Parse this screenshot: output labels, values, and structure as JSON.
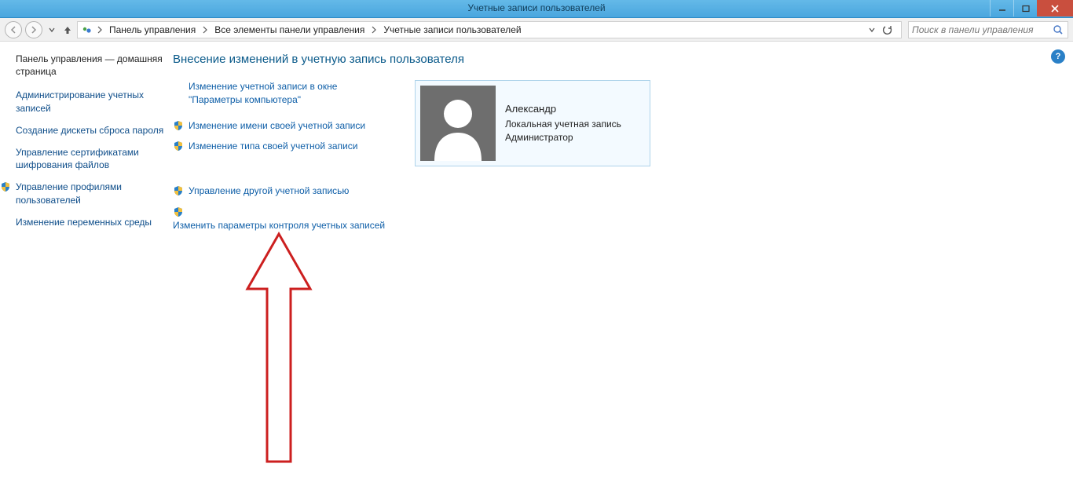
{
  "window": {
    "title": "Учетные записи пользователей"
  },
  "breadcrumb": {
    "items": [
      "Панель управления",
      "Все элементы панели управления",
      "Учетные записи пользователей"
    ]
  },
  "search": {
    "placeholder": "Поиск в панели управления"
  },
  "sidebar": {
    "heading": "Панель управления — домашняя страница",
    "links": [
      {
        "label": "Администрирование учетных записей",
        "shield": false
      },
      {
        "label": "Создание дискеты сброса пароля",
        "shield": false
      },
      {
        "label": "Управление сертификатами шифрования файлов",
        "shield": false
      },
      {
        "label": "Управление профилями пользователей",
        "shield": true
      },
      {
        "label": "Изменение переменных среды",
        "shield": false
      }
    ]
  },
  "main": {
    "heading": "Внесение изменений в учетную запись пользователя",
    "actions_group1": [
      {
        "label": "Изменение учетной записи в окне \"Параметры компьютера\"",
        "shield": false
      },
      {
        "label": "Изменение имени своей учетной записи",
        "shield": true
      },
      {
        "label": "Изменение типа своей учетной записи",
        "shield": true
      }
    ],
    "actions_group2": [
      {
        "label": "Управление другой учетной записью",
        "shield": true
      },
      {
        "label": "Изменить параметры контроля учетных записей",
        "shield": true
      }
    ],
    "user": {
      "name": "Александр",
      "type": "Локальная учетная запись",
      "role": "Администратор"
    }
  }
}
